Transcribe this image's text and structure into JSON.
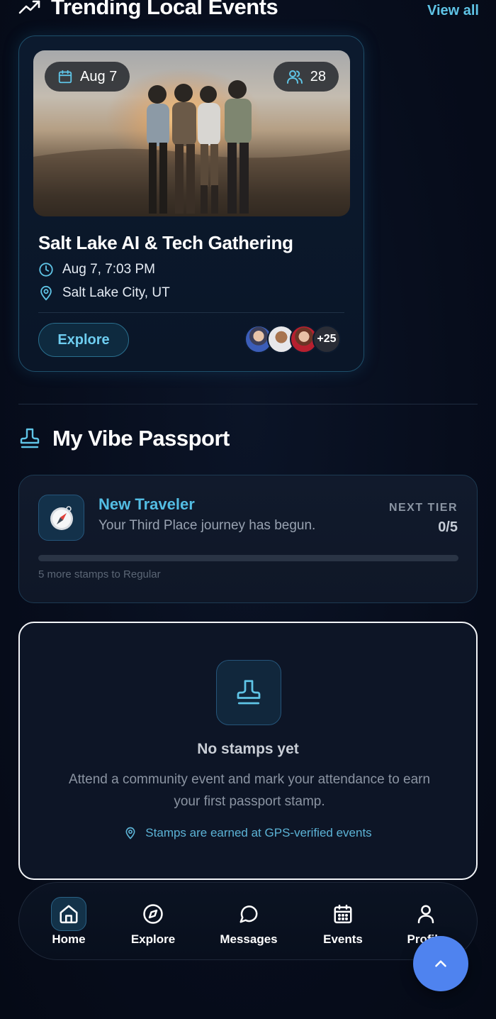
{
  "trending": {
    "title": "Trending Local Events",
    "view_all": "View all"
  },
  "event": {
    "date_chip": "Aug 7",
    "attendee_count": "28",
    "title": "Salt Lake AI & Tech Gathering",
    "datetime": "Aug 7, 7:03 PM",
    "location": "Salt Lake City, UT",
    "explore_label": "Explore",
    "more_attendees": "+25"
  },
  "passport": {
    "title": "My Vibe Passport",
    "tier_name": "New Traveler",
    "tier_subtitle": "Your Third Place journey has begun.",
    "next_tier_label": "NEXT TIER",
    "next_tier_value": "0/5",
    "progress_fraction": 0,
    "progress_note": "5 more stamps to Regular"
  },
  "empty_state": {
    "title": "No stamps yet",
    "description": "Attend a community event and mark your attendance to earn your first passport stamp.",
    "note": "Stamps are earned at GPS-verified events"
  },
  "nav": {
    "home": "Home",
    "explore": "Explore",
    "messages": "Messages",
    "events": "Events",
    "profile": "Profile"
  },
  "colors": {
    "accent": "#53bde3",
    "fab": "#4f83ef",
    "background": "#070d1c"
  }
}
